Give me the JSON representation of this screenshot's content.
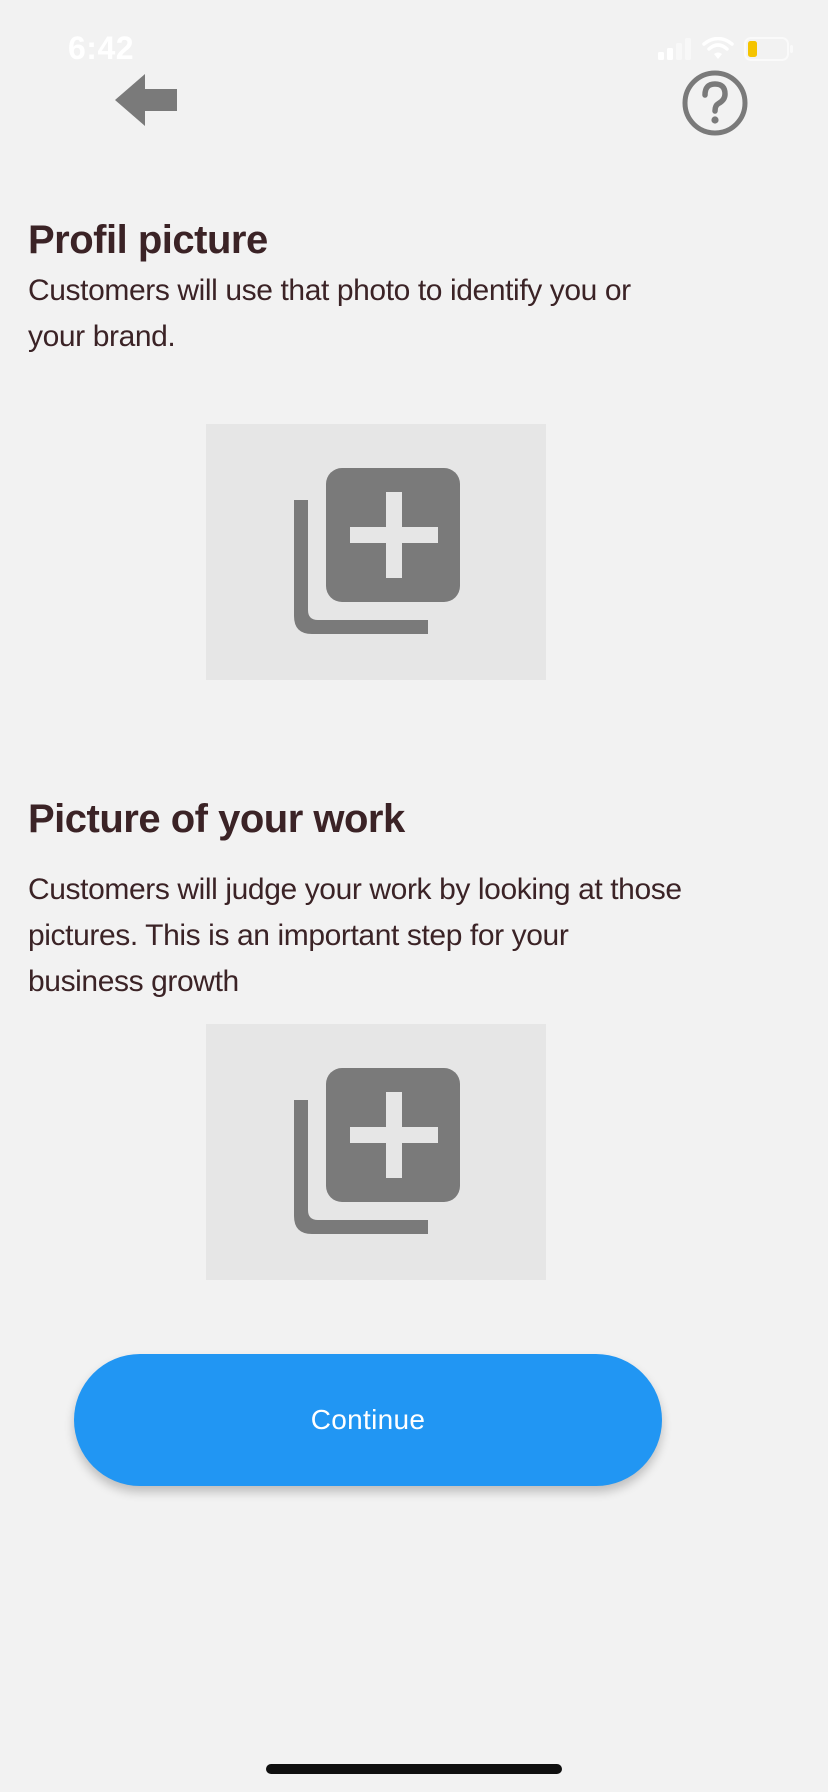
{
  "status_bar": {
    "time": "6:42",
    "icons": [
      "signal-icon",
      "wifi-icon",
      "battery-icon"
    ],
    "battery_color": "#f5c400"
  },
  "header": {
    "back_icon": "arrow-left-icon",
    "help_icon": "question-circle-icon",
    "icon_color": "#7a7a7a"
  },
  "profile_section": {
    "title": "Profil picture",
    "description": "Customers will use that photo to identify you or your brand.",
    "upload_icon": "add-photo-library-icon"
  },
  "work_section": {
    "title": "Picture of your work",
    "description": "Customers will judge your work by looking at those pictures. This is an important step for your business growth",
    "upload_icon": "add-photo-library-icon"
  },
  "continue_button": {
    "label": "Continue",
    "color": "#2196f3"
  },
  "colors": {
    "background": "#f2f2f2",
    "text": "#3b2326",
    "placeholder": "#e6e6e6"
  }
}
